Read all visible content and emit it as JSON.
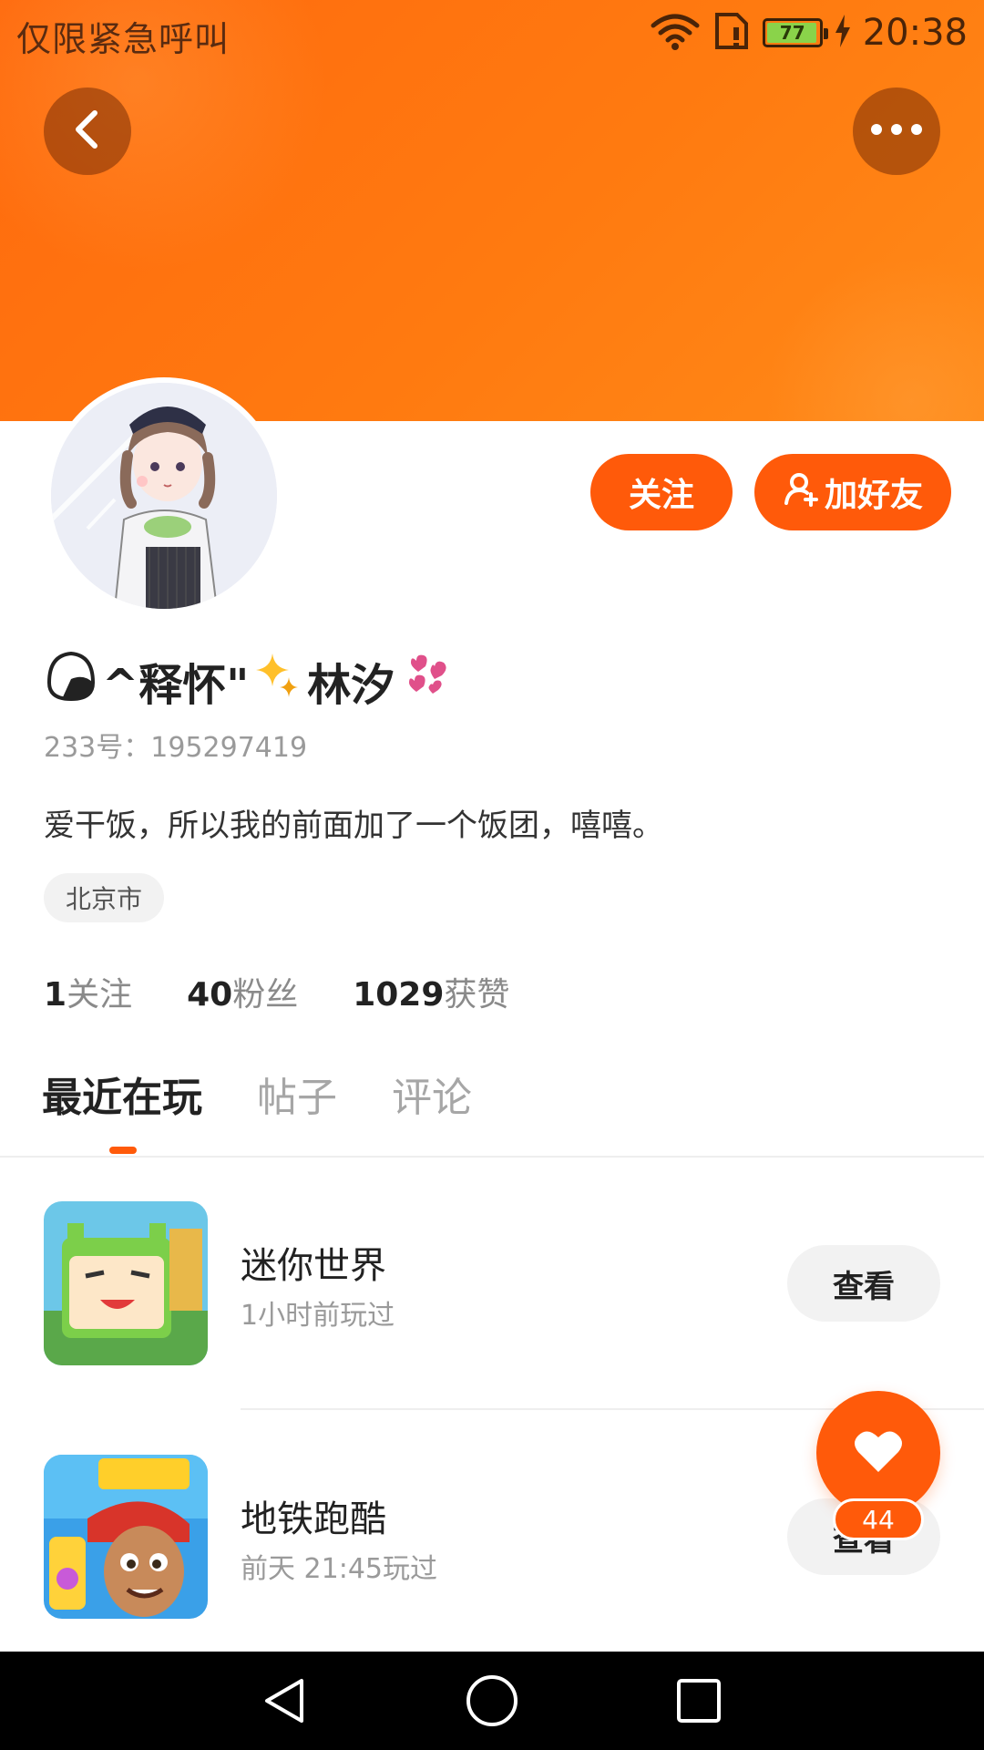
{
  "status_bar": {
    "carrier_text": "仅限紧急呼叫",
    "battery_level": "77",
    "time": "20:38",
    "icons": [
      "wifi-icon",
      "sim-icon",
      "battery-icon",
      "charging-icon"
    ]
  },
  "header": {
    "back_icon": "chevron-left-icon",
    "more_icon": "more-dots-icon",
    "colors": {
      "gradient_start": "#ff6a0e",
      "gradient_end": "#ff8a18"
    }
  },
  "actions": {
    "follow_label": "关注",
    "add_friend_label": "加好友",
    "add_friend_icon": "add-user-icon",
    "accent": "#ff5a0a"
  },
  "profile": {
    "nickname_prefix": "^释怀\"",
    "nickname_suffix": "林汐",
    "nickname_emojis": [
      "rice-ball-icon",
      "sparkle-icon",
      "hearts-icon"
    ],
    "user_id": "233号：195297419",
    "bio": "爱干饭，所以我的前面加了一个饭团，嘻嘻。",
    "location": "北京市"
  },
  "stats": [
    {
      "count": "1",
      "label": "关注"
    },
    {
      "count": "40",
      "label": "粉丝"
    },
    {
      "count": "1029",
      "label": "获赞"
    }
  ],
  "tabs": [
    {
      "label": "最近在玩",
      "active": true
    },
    {
      "label": "帖子",
      "active": false
    },
    {
      "label": "评论",
      "active": false
    }
  ],
  "games": [
    {
      "name": "迷你世界",
      "last_played": "1小时前玩过",
      "button": "查看"
    },
    {
      "name": "地铁跑酷",
      "last_played": "前天 21:45玩过",
      "button": "查看"
    }
  ],
  "like_fab": {
    "icon": "heart-icon",
    "count": "44"
  },
  "nav_bar": {
    "icons": [
      "nav-back-icon",
      "nav-home-icon",
      "nav-recent-icon"
    ]
  }
}
